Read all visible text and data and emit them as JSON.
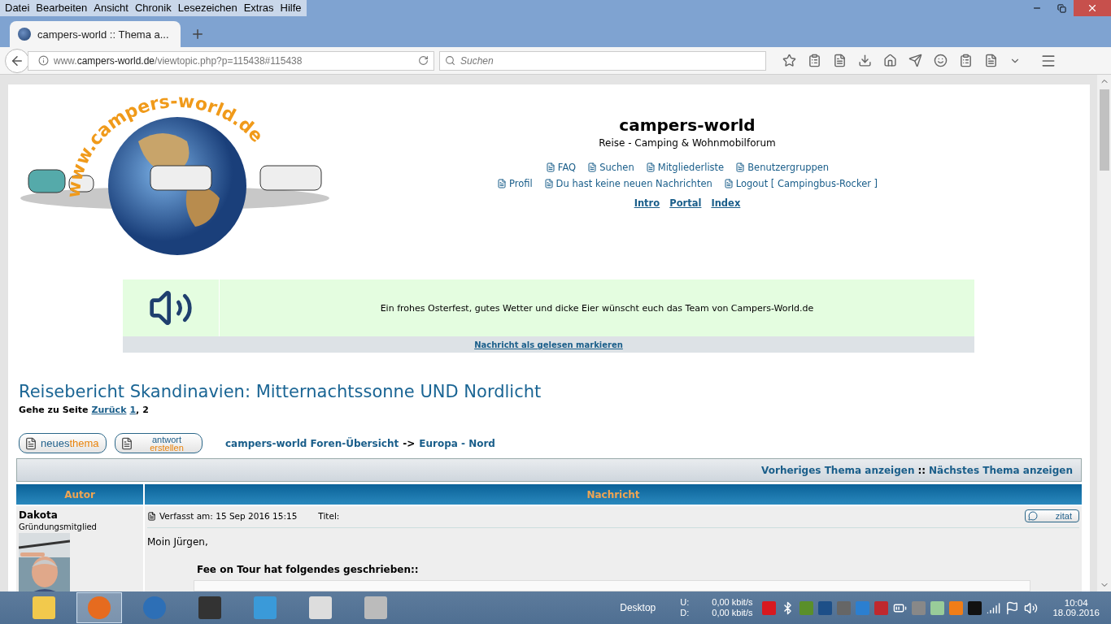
{
  "browser": {
    "menu": [
      {
        "label": "Datei"
      },
      {
        "label": "Bearbeiten"
      },
      {
        "label": "Ansicht"
      },
      {
        "label": "Chronik"
      },
      {
        "label": "Lesezeichen"
      },
      {
        "label": "Extras"
      },
      {
        "label": "Hilfe"
      }
    ],
    "tab": {
      "title": "campers-world :: Thema a...",
      "selected": true
    },
    "url": {
      "prefix": "www.",
      "domain": "campers-world.de",
      "path": "/viewtopic.php?p=115438#115438"
    },
    "search": {
      "placeholder": "Suchen"
    }
  },
  "site": {
    "logo_text": "www.campers-world.de",
    "title": "campers-world",
    "subtitle": "Reise - Camping & Wohnmobilforum",
    "nav_rows": [
      [
        {
          "label": "FAQ"
        },
        {
          "label": "Suchen"
        },
        {
          "label": "Mitgliederliste"
        },
        {
          "label": "Benutzergruppen"
        }
      ],
      [
        {
          "label": "Profil"
        },
        {
          "label": "Du hast keine neuen Nachrichten"
        },
        {
          "label": "Logout [ Campingbus-Rocker ]"
        }
      ]
    ],
    "main_links": [
      {
        "label": "Intro"
      },
      {
        "label": "Portal"
      },
      {
        "label": "Index"
      }
    ]
  },
  "banner": {
    "message": "Ein frohes Osterfest, gutes Wetter und dicke Eier wünscht euch das Team von Campers-World.de",
    "mark_read": "Nachricht als gelesen markieren"
  },
  "topic": {
    "title": "Reisebericht Skandinavien: Mitternachtssonne UND Nordlicht",
    "pagination": {
      "label": "Gehe zu Seite",
      "back": "Zurück",
      "separator": ",",
      "pages": [
        {
          "label": "1",
          "selected": false
        },
        {
          "label": "2",
          "selected": true
        }
      ]
    },
    "buttons": [
      {
        "top": "neues",
        "bottom": "thema",
        "kind": "inline"
      },
      {
        "top": "antwort",
        "bottom": "erstellen",
        "kind": "stacked"
      }
    ],
    "breadcrumb": {
      "home": "campers-world Foren-Übersicht",
      "arrow": "->",
      "forum": "Europa - Nord"
    },
    "topic_nav": {
      "previous": "Vorheriges Thema anzeigen",
      "separator": "::",
      "next": "Nächstes Thema anzeigen"
    },
    "columns": [
      "Autor",
      "Nachricht"
    ],
    "post": {
      "author": "Dakota",
      "rank": "Gründungsmitglied",
      "posted": "Verfasst am: 15 Sep 2016 15:15",
      "title_label": "Titel:",
      "quote_button": "zitat",
      "greeting": "Moin Jürgen,",
      "quote_header": "Fee on Tour hat folgendes geschrieben::"
    }
  },
  "taskbar": {
    "desktop": "Desktop",
    "upload_label": "U:",
    "upload": "0,00 kbit/s",
    "download_label": "D:",
    "download": "0,00 kbit/s",
    "time": "10:04",
    "date": "18.09.2016"
  }
}
